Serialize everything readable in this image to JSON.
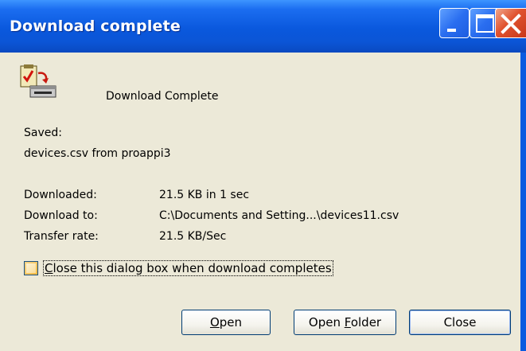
{
  "window": {
    "title": "Download complete"
  },
  "header": {
    "status": "Download Complete"
  },
  "saved": {
    "label": "Saved:",
    "file": "devices.csv from proappi3"
  },
  "details": [
    {
      "label": "Downloaded:",
      "value": "21.5 KB in 1 sec"
    },
    {
      "label": "Download to:",
      "value": "C:\\Documents and Setting...\\devices11.csv"
    },
    {
      "label": "Transfer rate:",
      "value": "21.5 KB/Sec"
    }
  ],
  "checkbox": {
    "pre": "C",
    "rest": "lose this dialog box when download completes",
    "checked": false
  },
  "buttons": {
    "open": {
      "u": "O",
      "rest": "pen"
    },
    "open_folder": {
      "pre": "Open ",
      "u": "F",
      "rest": "older"
    },
    "close": {
      "label": "Close"
    }
  },
  "icons": {
    "file": "download-file-icon"
  }
}
